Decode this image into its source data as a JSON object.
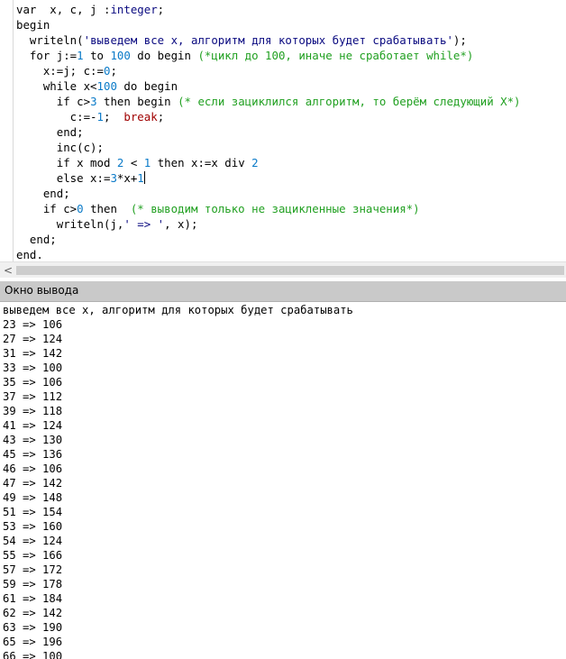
{
  "editor": {
    "lines": [
      [
        [
          "var  x, c, j :",
          "kw"
        ],
        [
          "integer",
          "type"
        ],
        [
          ";",
          "kw"
        ]
      ],
      [
        [
          "begin",
          "kw"
        ]
      ],
      [
        [
          "  writeln(",
          "kw"
        ],
        [
          "'выведем все x, алгоритм для которых будет срабатывать'",
          "str"
        ],
        [
          ");",
          "kw"
        ]
      ],
      [
        [
          "  for j:=",
          "kw"
        ],
        [
          "1",
          "num"
        ],
        [
          " to ",
          "kw"
        ],
        [
          "100",
          "num"
        ],
        [
          " do begin ",
          "kw"
        ],
        [
          "(*цикл до 100, иначе не сработает while*)",
          "cmt"
        ]
      ],
      [
        [
          "    x:=j; c:=",
          "kw"
        ],
        [
          "0",
          "num"
        ],
        [
          ";",
          "kw"
        ]
      ],
      [
        [
          "    while x<",
          "kw"
        ],
        [
          "100",
          "num"
        ],
        [
          " do begin",
          "kw"
        ]
      ],
      [
        [
          "      if c>",
          "kw"
        ],
        [
          "3",
          "num"
        ],
        [
          " then begin ",
          "kw"
        ],
        [
          "(* если зациклился алгоритм, то берём следующий X*)",
          "cmt"
        ]
      ],
      [
        [
          "        c:=-",
          "kw"
        ],
        [
          "1",
          "num"
        ],
        [
          ";  ",
          "kw"
        ],
        [
          "break",
          "brk"
        ],
        [
          ";",
          "kw"
        ]
      ],
      [
        [
          "      end;",
          "kw"
        ]
      ],
      [
        [
          "      inc(c);",
          "kw"
        ]
      ],
      [
        [
          "      if x mod ",
          "kw"
        ],
        [
          "2",
          "num"
        ],
        [
          " < ",
          "kw"
        ],
        [
          "1",
          "num"
        ],
        [
          " then x:=x div ",
          "kw"
        ],
        [
          "2",
          "num"
        ]
      ],
      [
        [
          "      else x:=",
          "kw"
        ],
        [
          "3",
          "num"
        ],
        [
          "*x+",
          "kw"
        ],
        [
          "1",
          "num"
        ],
        [
          "",
          "caret"
        ]
      ],
      [
        [
          "    end;",
          "kw"
        ]
      ],
      [
        [
          "    if c>",
          "kw"
        ],
        [
          "0",
          "num"
        ],
        [
          " then  ",
          "kw"
        ],
        [
          "(* выводим только не зацикленные значения*)",
          "cmt"
        ]
      ],
      [
        [
          "      writeln(j,",
          "kw"
        ],
        [
          "' => '",
          "str"
        ],
        [
          ", x);",
          "kw"
        ]
      ],
      [
        [
          "  end;",
          "kw"
        ]
      ],
      [
        [
          "end.",
          "kw"
        ]
      ]
    ]
  },
  "scrollbar": {
    "left_arrow": "<"
  },
  "output_panel": {
    "title": "Окно вывода",
    "lines": [
      "выведем все x, алгоритм для которых будет срабатывать",
      "23 => 106",
      "27 => 124",
      "31 => 142",
      "33 => 100",
      "35 => 106",
      "37 => 112",
      "39 => 118",
      "41 => 124",
      "43 => 130",
      "45 => 136",
      "46 => 106",
      "47 => 142",
      "49 => 148",
      "51 => 154",
      "53 => 160",
      "54 => 124",
      "55 => 166",
      "57 => 172",
      "59 => 178",
      "61 => 184",
      "62 => 142",
      "63 => 190",
      "65 => 196",
      "66 => 100"
    ]
  }
}
